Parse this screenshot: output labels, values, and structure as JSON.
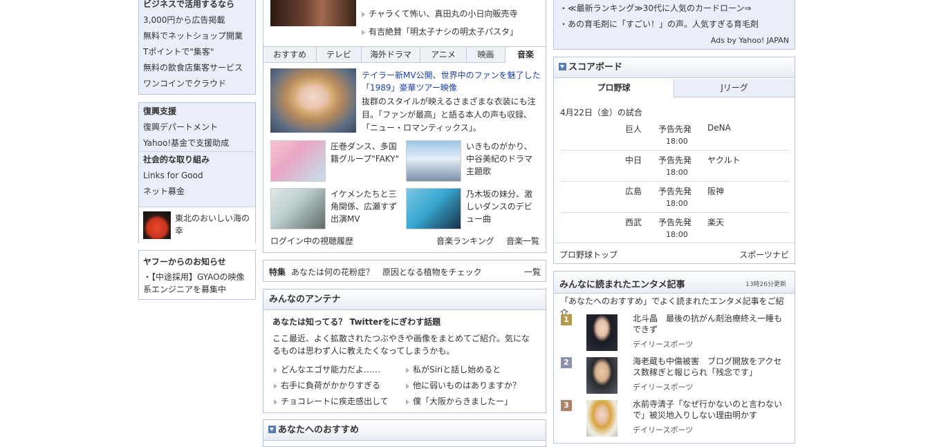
{
  "left": {
    "biz": {
      "heading": "ビジネスで活用するなら",
      "items": [
        "3,000円から広告掲載",
        "無料でネットショップ開業",
        "Tポイントで\"集客\"",
        "無料の飲食店集客サービス",
        "ワンコインでクラウド"
      ]
    },
    "support": {
      "heading1": "復興支援",
      "items1": [
        "復興デパートメント",
        "Yahoo!基金で支援助成"
      ],
      "heading2": "社会的な取り組み",
      "items2": [
        "Links for Good",
        "ネット募金"
      ],
      "promo": "東北のおいしい海の幸"
    },
    "notice": {
      "heading": "ヤフーからのお知らせ",
      "item": "・【中途採用】GYAOの映像系エンジニアを募集中"
    }
  },
  "media": {
    "top_links": [
      "チャラくて怖い、真田丸の小日向販売寺",
      "有吉絶賛「明太子ナシの明太子パスタ」"
    ],
    "tabs": [
      "おすすめ",
      "テレビ",
      "海外ドラマ",
      "アニメ",
      "映画",
      "音楽"
    ],
    "active_tab": "音楽",
    "lead": {
      "title": "テイラー新MV公開、世界中のファンを魅了した「1989」豪華ツアー映像",
      "desc": "抜群のスタイルが映えるさまざまな衣装にも注目。「ファンが最高」と語る本人の声も収録、「ニュー・ロマンティックス」。"
    },
    "cards": [
      {
        "text": "圧巻ダンス、多国籍グループ\"FAKY\""
      },
      {
        "text": "いきものがかり、中谷美紀のドラマ主題歌"
      },
      {
        "text": "イケメンたちと三角関係、広瀬すず出演MV"
      },
      {
        "text": "乃木坂の妹分、激しいダンスのデビュー曲"
      }
    ],
    "footer": {
      "history": "ログイン中の視聴履歴",
      "ranking": "音楽ランキング",
      "list": "音楽一覧"
    }
  },
  "special": {
    "label": "特集",
    "text": "あなたは何の花粉症？　原因となる植物をチェック",
    "more": "一覧"
  },
  "antenna": {
    "title": "みんなのアンテナ",
    "headline": "あなたは知ってる？ Twitterをにぎわす話題",
    "desc": "ここ最近、よく拡散されたつぶやきや画像をまとめてご紹介。気になるものは思わず人に教えたくなってしまうかも。",
    "links": [
      "どんなエゴサ能力だよ……",
      "私がSiriと話し始めると",
      "右手に負荷がかかりすぎる",
      "他に弱いものはありますか？",
      "チョコレートに疾走感出して",
      "僕「大阪からきましたー」"
    ]
  },
  "recommend": {
    "title": "あなたへのおすすめ"
  },
  "ads": {
    "items": [
      "・≪最新ランキング≫30代に人気のカードローン⇒",
      "・あの育毛剤に「すごい！」の声。人気すぎる育毛剤"
    ],
    "credit": "Ads by Yahoo! JAPAN"
  },
  "scoreboard": {
    "title": "スコアボード",
    "tabs": [
      "プロ野球",
      "Jリーグ"
    ],
    "date": "4月22日（金）の試合",
    "games": [
      {
        "home": "巨人",
        "status": "予告先発",
        "away": "DeNA",
        "time": "18:00"
      },
      {
        "home": "中日",
        "status": "予告先発",
        "away": "ヤクルト",
        "time": "18:00"
      },
      {
        "home": "広島",
        "status": "予告先発",
        "away": "阪神",
        "time": "18:00"
      },
      {
        "home": "西武",
        "status": "予告先発",
        "away": "楽天",
        "time": "18:00"
      }
    ],
    "links": {
      "left": "プロ野球トップ",
      "right": "スポーツナビ"
    }
  },
  "ent": {
    "title": "みんなに読まれたエンタメ記事",
    "updated": "13時26分更新",
    "intro": "「あなたへのおすすめ」でよく読まれたエンタメ記事をご紹介。",
    "items": [
      {
        "rank": "1",
        "title": "北斗晶　最後の抗がん剤治療終え一睡もできず",
        "source": "デイリースポーツ"
      },
      {
        "rank": "2",
        "title": "海老蔵も中傷被害　ブログ開放をアクセス数稼ぎと報じられ「残念です」",
        "source": "デイリースポーツ"
      },
      {
        "rank": "3",
        "title": "水前寺清子「なぜ行かないのと言わないで」被災地入りしない理由明かす",
        "source": "デイリースポーツ"
      }
    ],
    "rank_colors": [
      "#b59a4e",
      "#8a93a8",
      "#a9846b"
    ]
  }
}
